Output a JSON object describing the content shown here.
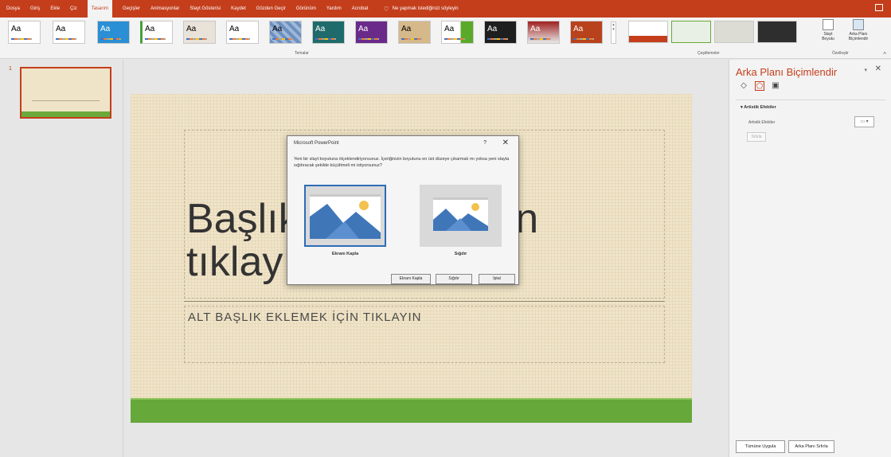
{
  "ribbon_tabs": [
    "Dosya",
    "Giriş",
    "Ekle",
    "Çiz",
    "Tasarım",
    "Geçişler",
    "Animasyonlar",
    "Slayt Gösterisi",
    "Kaydet",
    "Gözden Geçir",
    "Görünüm",
    "Yardım",
    "Acrobat"
  ],
  "active_tab": "Tasarım",
  "tell_me": "Ne yapmak istediğinizi söyleyin",
  "groups": {
    "themes": "Temalar",
    "variants": "Çeşitlemeler",
    "customize": "Özelleştir"
  },
  "theme_sample": "Aa",
  "customize_buttons": {
    "slide_size": "Slayt Boyutu",
    "format_background": "Arka Planı Biçimlendir"
  },
  "thumbnail": {
    "number": "1"
  },
  "slide": {
    "title": "Başlık eklemek için\ntıklayın",
    "subtitle": "ALT BAŞLIK EKLEMEK İÇİN TIKLAYIN"
  },
  "format_pane": {
    "title": "Arka Planı Biçimlendir",
    "section": "Artistik Efektler",
    "effects_label": "Artistik Efektler",
    "reset": "Sıfırla",
    "apply_all": "Tümüne Uygula",
    "reset_background": "Arka Planı Sıfırla"
  },
  "dialog": {
    "title": "Microsoft PowerPoint",
    "help": "?",
    "close": "✕",
    "message": "Yeni bir slayt boyutuna ölçeklendiriyorsunuz. İçeriğinizin boyutunu en üst düzeye çıkarmalı mı yoksa yeni slayta sığdıracak şekilde küçültmeli mi istiyorsunuz?",
    "option_maximize": "Ekranı Kapla",
    "option_fit": "Sığdır",
    "btn_maximize": "Ekranı Kapla",
    "btn_fit": "Sığdır",
    "btn_cancel": "İptal"
  },
  "colors": {
    "accent": "#c43e1c",
    "slide_bg": "#f0e4c8",
    "slide_green": "#66a83a",
    "dialog_selection": "#2e6cb5"
  }
}
